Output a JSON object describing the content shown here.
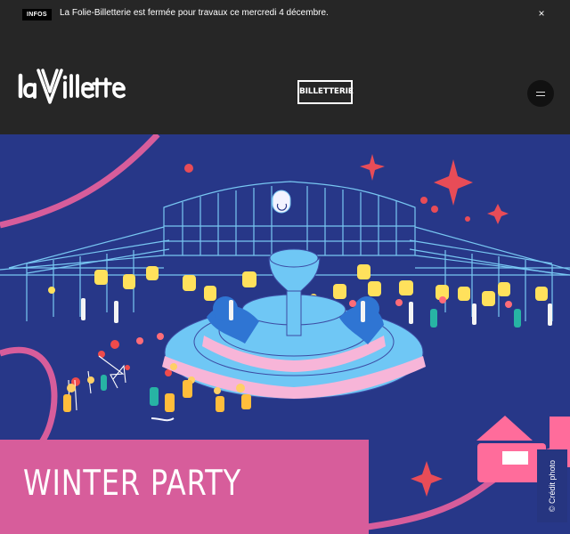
{
  "announcement": {
    "badge": "INFOS",
    "message": "La Folie-Billetterie est fermée pour travaux ce mercredi 4 décembre.",
    "close_glyph": "×"
  },
  "header": {
    "logo_text": "laVillette",
    "ticket_button_label": "BILLETTERIE",
    "menu_icon": "hamburger-icon"
  },
  "hero": {
    "title": "WINTER PARTY",
    "credit": "© Crédit photo",
    "colors": {
      "background": "#273788",
      "title_card": "#d75d9b"
    }
  }
}
